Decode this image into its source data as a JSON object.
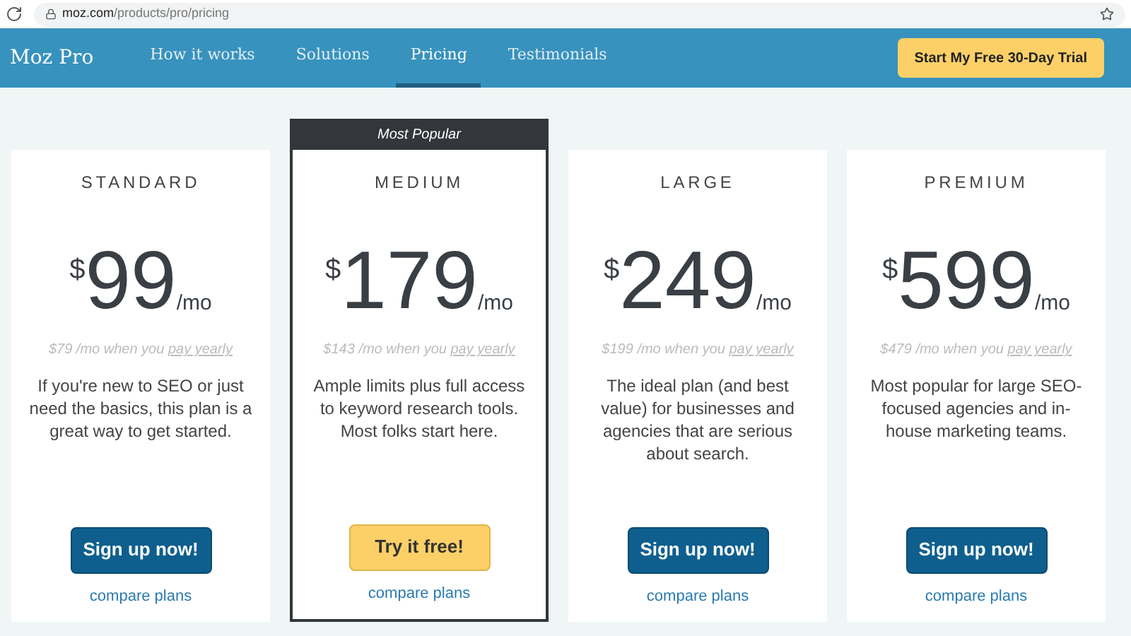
{
  "browser": {
    "url_host": "moz.com",
    "url_path": "/products/pro/pricing"
  },
  "nav": {
    "brand": "Moz Pro",
    "items": [
      {
        "label": "How it works",
        "selected": false
      },
      {
        "label": "Solutions",
        "selected": false
      },
      {
        "label": "Pricing",
        "selected": true
      },
      {
        "label": "Testimonials",
        "selected": false
      }
    ],
    "cta": "Start My Free 30-Day Trial"
  },
  "plans": [
    {
      "name": "STANDARD",
      "featured": false,
      "currency": "$",
      "price": "99",
      "per": "/mo",
      "yearly_text": "$79 /mo when you",
      "yearly_link": "pay yearly",
      "description": "If you're new to SEO or just need the basics, this plan is a great way to get started.",
      "button": {
        "label": "Sign up now!",
        "kind": "signup"
      },
      "compare": "compare plans"
    },
    {
      "name": "MEDIUM",
      "featured": true,
      "badge": "Most Popular",
      "currency": "$",
      "price": "179",
      "per": "/mo",
      "yearly_text": "$143 /mo when you",
      "yearly_link": "pay yearly",
      "description": "Ample limits plus full access to keyword research tools. Most folks start here.",
      "button": {
        "label": "Try it free!",
        "kind": "trial"
      },
      "compare": "compare plans"
    },
    {
      "name": "LARGE",
      "featured": false,
      "currency": "$",
      "price": "249",
      "per": "/mo",
      "yearly_text": "$199 /mo when you",
      "yearly_link": "pay yearly",
      "description": "The ideal plan (and best value) for businesses and agencies that are serious about search.",
      "button": {
        "label": "Sign up now!",
        "kind": "signup"
      },
      "compare": "compare plans"
    },
    {
      "name": "PREMIUM",
      "featured": false,
      "currency": "$",
      "price": "599",
      "per": "/mo",
      "yearly_text": "$479 /mo when you",
      "yearly_link": "pay yearly",
      "description": "Most popular for large SEO-focused agencies and in-house marketing teams.",
      "button": {
        "label": "Sign up now!",
        "kind": "signup"
      },
      "compare": "compare plans"
    }
  ]
}
